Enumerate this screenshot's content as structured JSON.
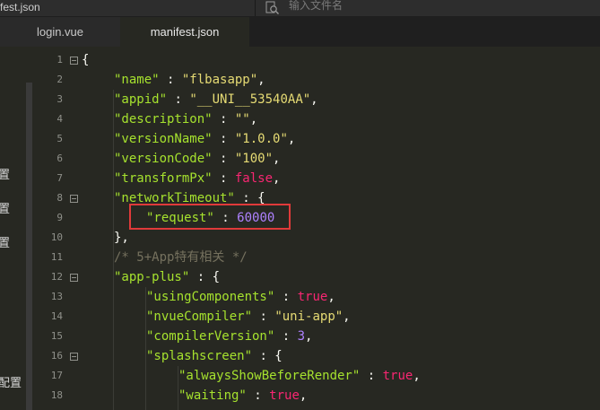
{
  "window": {
    "file_name": "fest.json"
  },
  "search": {
    "placeholder": "输入文件名"
  },
  "tabs": [
    {
      "label": "login.vue",
      "active": false
    },
    {
      "label": "manifest.json",
      "active": true
    }
  ],
  "sidebar": {
    "fragments": [
      "置",
      "置",
      "置",
      "配置"
    ]
  },
  "code": {
    "line_numbers": [
      "1",
      "2",
      "3",
      "4",
      "5",
      "6",
      "7",
      "8",
      "9",
      "10",
      "11",
      "12",
      "13",
      "14",
      "15",
      "16",
      "17",
      "18"
    ],
    "lines": {
      "l1": "{",
      "l2_key": "\"name\"",
      "l2_val": "\"flbasapp\"",
      "l3_key": "\"appid\"",
      "l3_val": "\"__UNI__53540AA\"",
      "l4_key": "\"description\"",
      "l4_val": "\"\"",
      "l5_key": "\"versionName\"",
      "l5_val": "\"1.0.0\"",
      "l6_key": "\"versionCode\"",
      "l6_val": "\"100\"",
      "l7_key": "\"transformPx\"",
      "l7_val": "false",
      "l8_key": "\"networkTimeout\"",
      "l9_key": "\"request\"",
      "l9_val": "60000",
      "l10": "},",
      "l11": "/* 5+App特有相关 */",
      "l12_key": "\"app-plus\"",
      "l13_key": "\"usingComponents\"",
      "l13_val": "true",
      "l14_key": "\"nvueCompiler\"",
      "l14_val": "\"uni-app\"",
      "l15_key": "\"compilerVersion\"",
      "l15_val": "3",
      "l16_key": "\"splashscreen\"",
      "l17_key": "\"alwaysShowBeforeRender\"",
      "l17_val": "true",
      "l18_key": "\"waiting\"",
      "l18_val": "true"
    }
  },
  "colors": {
    "highlight_box": "#e03a3a",
    "key": "#a6e22e",
    "string": "#e6db74",
    "number": "#ae81ff",
    "comment": "#75715e"
  }
}
